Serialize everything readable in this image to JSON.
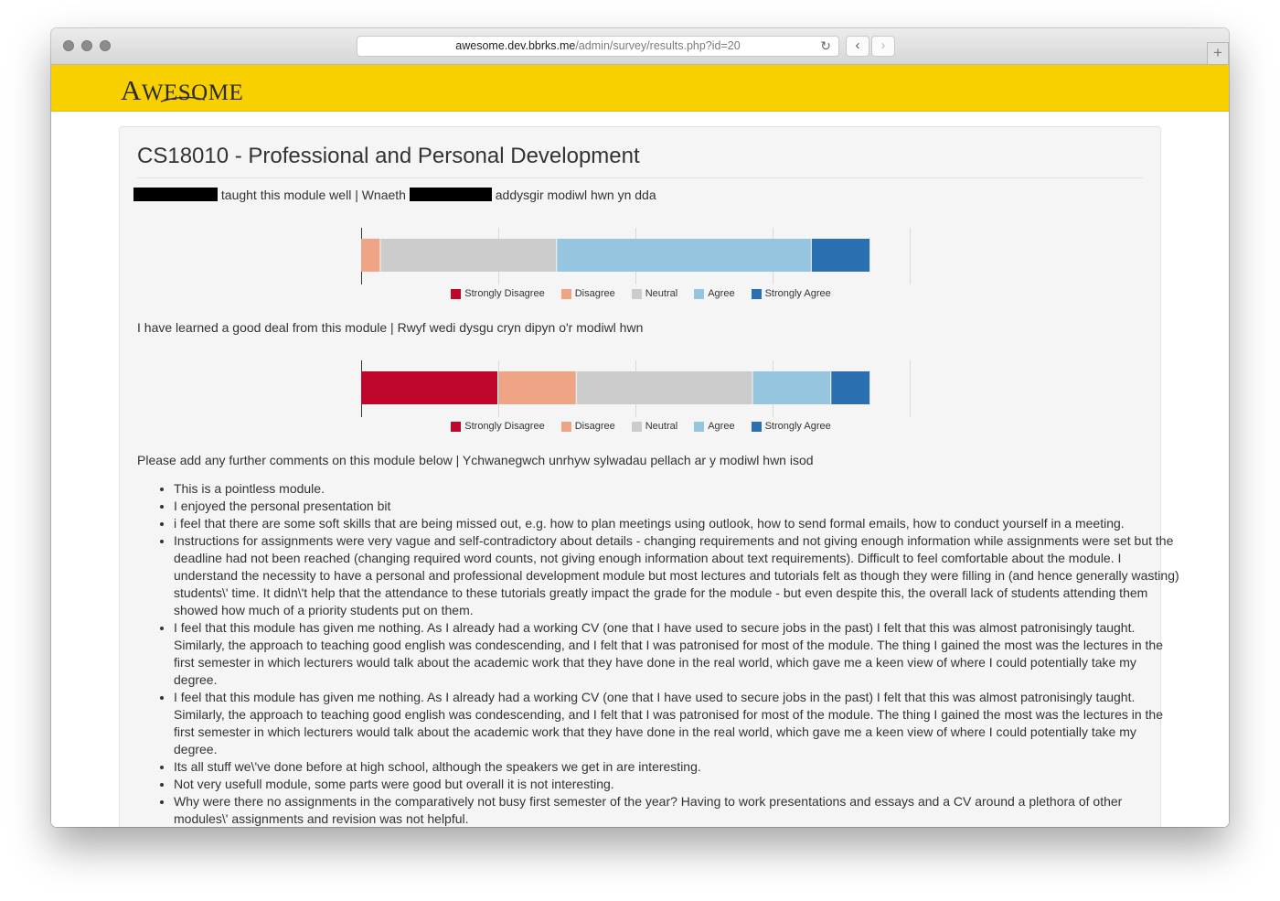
{
  "browser": {
    "url_host": "awesome.dev.bbrks.me",
    "url_path": "/admin/survey/results.php?id=20",
    "reload_icon": "reload-icon",
    "back_icon": "chevron-left-icon",
    "forward_icon": "chevron-right-icon",
    "new_tab_icon": "plus-icon"
  },
  "header": {
    "logo_big": "A",
    "logo_rest": "WESOME",
    "background": "#f8d000"
  },
  "page": {
    "title": "CS18010 - Professional and Personal Development",
    "q1": {
      "text_mid": "taught this module well | Wnaeth",
      "text_end": "addysgir modiwl hwn yn dda"
    },
    "q2": {
      "text": "I have learned a good deal from this module | Rwyf wedi dysgu cryn dipyn o'r modiwl hwn"
    },
    "q3": {
      "text": "Please add any further comments on this module below | Ychwanegwch unrhyw sylwadau pellach ar y modiwl hwn isod"
    }
  },
  "chart_data": [
    {
      "type": "bar",
      "orientation": "horizontal",
      "stacked": true,
      "categories": [
        "taught this module well"
      ],
      "series": [
        {
          "name": "Strongly Disagree",
          "values": [
            0
          ],
          "color": "#c0062b"
        },
        {
          "name": "Disagree",
          "values": [
            1
          ],
          "color": "#eea485"
        },
        {
          "name": "Neutral",
          "values": [
            9
          ],
          "color": "#cccccc"
        },
        {
          "name": "Agree",
          "values": [
            13
          ],
          "color": "#96c5df"
        },
        {
          "name": "Strongly Agree",
          "values": [
            3
          ],
          "color": "#2a6fb0"
        }
      ],
      "xlim": [
        0,
        28
      ],
      "grid": true,
      "legend": "bottom"
    },
    {
      "type": "bar",
      "orientation": "horizontal",
      "stacked": true,
      "categories": [
        "learned a good deal"
      ],
      "series": [
        {
          "name": "Strongly Disagree",
          "values": [
            7
          ],
          "color": "#c0062b"
        },
        {
          "name": "Disagree",
          "values": [
            4
          ],
          "color": "#eea485"
        },
        {
          "name": "Neutral",
          "values": [
            9
          ],
          "color": "#cccccc"
        },
        {
          "name": "Agree",
          "values": [
            4
          ],
          "color": "#96c5df"
        },
        {
          "name": "Strongly Agree",
          "values": [
            2
          ],
          "color": "#2a6fb0"
        }
      ],
      "xlim": [
        0,
        28
      ],
      "grid": true,
      "legend": "bottom"
    }
  ],
  "comments": [
    "This is a pointless module.",
    "I enjoyed the personal presentation bit",
    "i feel that there are some soft skills that are being missed out, e.g. how to plan meetings using outlook, how to send formal emails, how to conduct yourself in a meeting.",
    "Instructions for assignments were very vague and self-contradictory about details - changing requirements and not giving enough information while assignments were set but the deadline had not been reached (changing required word counts, not giving enough information about text requirements). Difficult to feel comfortable about the module. I understand the necessity to have a personal and professional development module but most lectures and tutorials felt as though they were filling in (and hence generally wasting) students\\' time. It didn\\'t help that the attendance to these tutorials greatly impact the grade for the module - but even despite this, the overall lack of students attending them showed how much of a priority students put on them.",
    "I feel that this module has given me nothing. As I already had a working CV (one that I have used to secure jobs in the past) I felt that this was almost patronisingly taught. Similarly, the approach to teaching good english was condescending, and I felt that I was patronised for most of the module. The thing I gained the most was the lectures in the first semester in which lecturers would talk about the academic work that they have done in the real world, which gave me a keen view of where I could potentially take my degree.",
    "I feel that this module has given me nothing. As I already had a working CV (one that I have used to secure jobs in the past) I felt that this was almost patronisingly taught. Similarly, the approach to teaching good english was condescending, and I felt that I was patronised for most of the module. The thing I gained the most was the lectures in the first semester in which lecturers would talk about the academic work that they have done in the real world, which gave me a keen view of where I could potentially take my degree.",
    "Its all stuff we\\'ve done before at high school, although the speakers we get in are interesting.",
    "Not very usefull module, some parts were good but overall it is not interesting.",
    "Why were there no assignments in the comparatively not busy first semester of the year? Having to work presentations and essays and a CV around a plethora of other modules\\' assignments and revision was not helpful."
  ]
}
